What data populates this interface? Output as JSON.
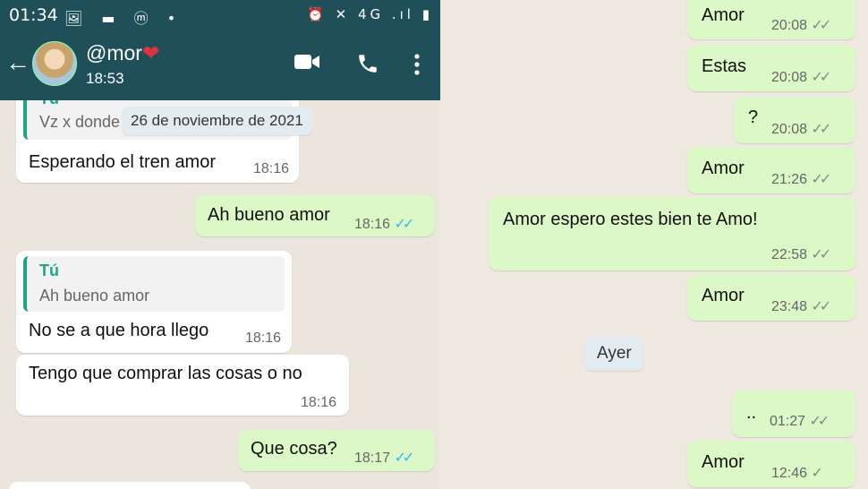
{
  "status_bar": {
    "time": "01:34",
    "left_icons": "🖼 ▬ ⓜ •",
    "right_icons": "⏰ ✕ 4G .ıl ▮"
  },
  "header": {
    "contact_name": "@mor",
    "heart": "❤",
    "subtitle": "18:53",
    "back_icon": "arrow-left",
    "video_icon": "video-camera",
    "call_icon": "phone",
    "menu_icon": "more-vertical"
  },
  "left_chat": {
    "msg1": {
      "quote_author": "Tú",
      "quote_text": "Vz x donde",
      "date_chip": "26 de noviembre de 2021",
      "text": "Esperando el tren amor",
      "time": "18:16"
    },
    "msg2": {
      "text": "Ah bueno amor",
      "time": "18:16",
      "ticks": "✓✓"
    },
    "msg3": {
      "quote_author": "Tú",
      "quote_text": "Ah bueno amor",
      "text": "No se a que hora llego",
      "time": "18:16"
    },
    "msg4": {
      "text": "Tengo que comprar las cosas o no",
      "time": "18:16"
    },
    "msg5": {
      "text": "Que cosa?",
      "time": "18:17",
      "ticks": "✓✓"
    }
  },
  "right_chat": {
    "msg1": {
      "text": "Amor",
      "time": "20:08",
      "ticks": "✓✓"
    },
    "msg2": {
      "text": "Estas",
      "time": "20:08",
      "ticks": "✓✓"
    },
    "msg3": {
      "text": "?",
      "time": "20:08",
      "ticks": "✓✓"
    },
    "msg4": {
      "text": "Amor",
      "time": "21:26",
      "ticks": "✓✓"
    },
    "msg5": {
      "text": "Amor espero estes bien te Amo!",
      "time": "22:58",
      "ticks": "✓✓"
    },
    "msg6": {
      "text": "Amor",
      "time": "23:48",
      "ticks": "✓✓"
    },
    "date_chip": "Ayer",
    "msg7": {
      "text": "..",
      "time": "01:27",
      "ticks": "✓✓"
    },
    "msg8": {
      "text": "Amor",
      "time": "12:46",
      "ticks": "✓"
    }
  },
  "colors": {
    "header": "#1f5059",
    "outgoing": "#dcf8c6",
    "incoming": "#ffffff",
    "read_ticks": "#34b7f1",
    "quote_accent": "#1fa486"
  }
}
